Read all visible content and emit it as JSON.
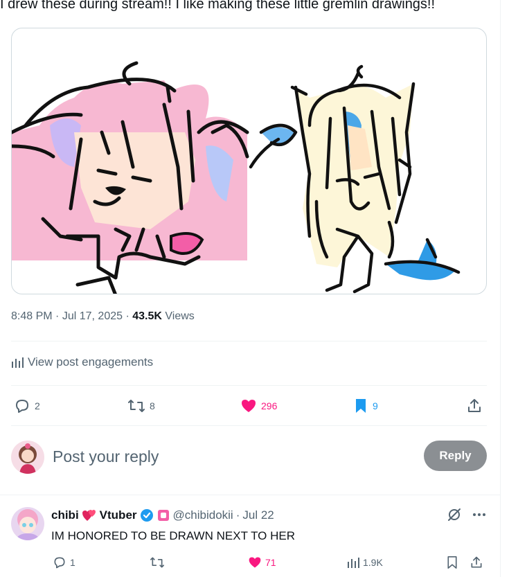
{
  "post": {
    "text": "I drew these during stream!! I like making these little gremlin drawings!!",
    "time": "8:48 PM",
    "date": "Jul 17, 2025",
    "views_count": "43.5K",
    "views_label": "Views",
    "engagements_label": "View post engagements"
  },
  "actions": {
    "replies": "2",
    "reposts": "8",
    "likes": "296",
    "bookmarks": "9"
  },
  "reply_box": {
    "placeholder": "Post your reply",
    "button_label": "Reply"
  },
  "reply": {
    "display_name_1": "chibi",
    "display_name_2": "Vtuber",
    "handle": "@chibidokii",
    "date": "Jul 22",
    "text": "IM HONORED TO BE DRAWN NEXT TO HER",
    "replies": "1",
    "likes": "71",
    "views": "1.9K"
  },
  "colors": {
    "like_pink": "#f91880",
    "bookmark_blue": "#1d9bf0",
    "muted_text": "#536471",
    "verified_blue": "#1d9bf0"
  },
  "icons": [
    "reply-icon",
    "repost-icon",
    "like-icon",
    "bookmark-icon",
    "share-icon",
    "analytics-icon",
    "verified-badge-icon",
    "heart-emoji-icon",
    "grok-icon",
    "more-icon"
  ]
}
